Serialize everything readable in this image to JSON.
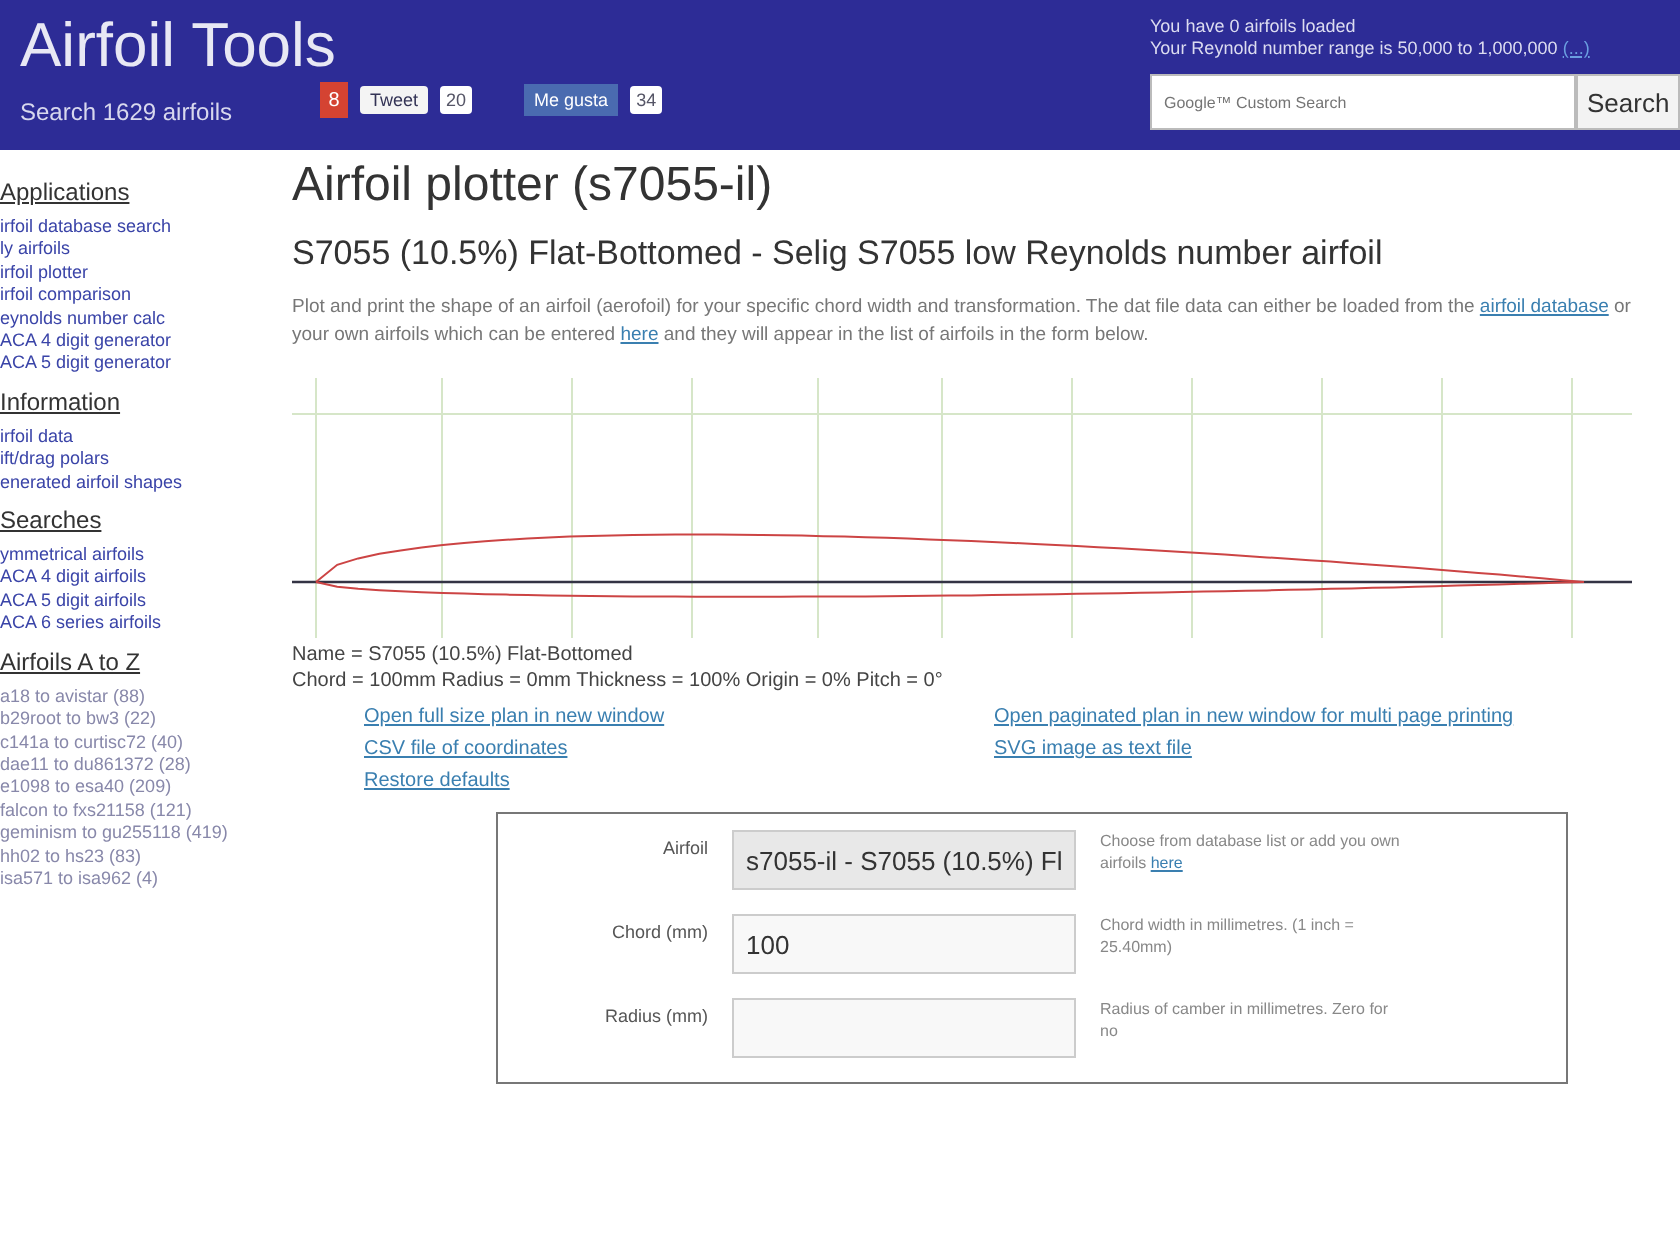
{
  "header": {
    "title": "Airfoil Tools",
    "subtitle": "Search 1629 airfoils",
    "social": [
      {
        "kind": "gplus",
        "label": "8"
      },
      {
        "kind": "tweet",
        "label": "Tweet",
        "count": "20"
      },
      {
        "kind": "like",
        "label": "Me gusta",
        "count": "34"
      }
    ],
    "status": [
      "You have 0 airfoils loaded",
      "Your Reynold number range is 50,000 to 1,000,000"
    ],
    "status_link": "(...)",
    "search": {
      "placeholder": "Google™ Custom Search",
      "button": "Search"
    }
  },
  "sidebar": [
    {
      "heading": "Applications",
      "items": [
        "irfoil database search",
        "ly airfoils",
        "irfoil plotter",
        "irfoil comparison",
        "eynolds number calc",
        "ACA 4 digit generator",
        "ACA 5 digit generator"
      ]
    },
    {
      "heading": "Information",
      "items": [
        "irfoil data",
        "ift/drag polars",
        "enerated airfoil shapes"
      ]
    },
    {
      "heading": "Searches",
      "items": [
        "ymmetrical airfoils",
        "ACA 4 digit airfoils",
        "ACA 5 digit airfoils",
        "ACA 6 series airfoils"
      ]
    },
    {
      "heading": "Airfoils A to Z",
      "items": [
        "a18 to avistar (88)",
        "b29root to bw3 (22)",
        "c141a to curtisc72 (40)",
        "dae11 to du861372 (28)",
        "e1098 to esa40 (209)",
        "falcon to fxs21158 (121)",
        "geminism to gu255118 (419)",
        "hh02 to hs23 (83)",
        "isa571 to isa962 (4)"
      ]
    }
  ],
  "main": {
    "title": "Airfoil plotter (s7055-il)",
    "subtitle": "S7055 (10.5%) Flat-Bottomed - Selig S7055 low Reynolds number airfoil",
    "intro": [
      "Plot and print the shape of an airfoil (aerofoil) for your specific chord width and transformation. The dat file data can either be loaded from the ",
      {
        "link": "airfoil database"
      },
      " or your own airfoils which can be entered ",
      {
        "link": "here"
      },
      " and they will appear in the list of airfoils in the form below."
    ],
    "info": [
      "Name = S7055 (10.5%) Flat-Bottomed",
      "Chord = 100mm Radius = 0mm Thickness = 100% Origin = 0% Pitch = 0°"
    ],
    "links": [
      "Open full size plan in new window",
      "Open paginated plan in new window for multi page printing",
      "CSV file of coordinates",
      "SVG image as text file",
      "Restore defaults"
    ],
    "form": [
      {
        "kind": "select",
        "label": "Airfoil",
        "value": "s7055-il - S7055 (10.5%) Fl",
        "help": "Choose from database list or add you own airfoils ",
        "help_link": "here"
      },
      {
        "kind": "input",
        "label": "Chord (mm)",
        "value": "100",
        "help": "Chord width in millimetres. (1 inch = 25.40mm)"
      },
      {
        "kind": "input",
        "label": "Radius (mm)",
        "help": "Radius of camber in millimetres. Zero for no"
      }
    ]
  }
}
